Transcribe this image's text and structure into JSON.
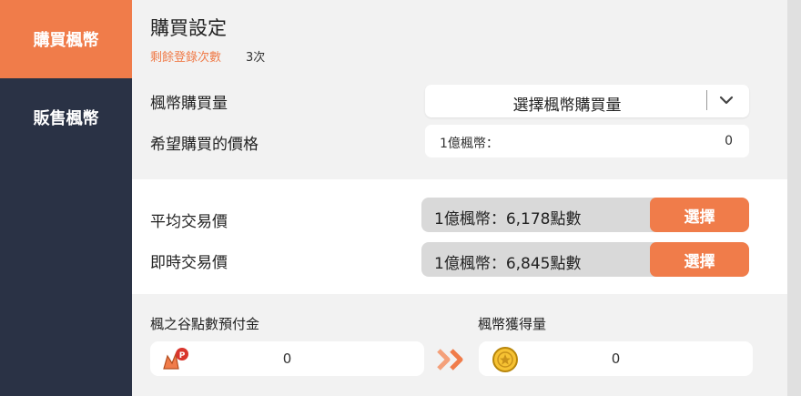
{
  "sidebar": {
    "tabs": [
      {
        "label": "購買楓幣",
        "active": true
      },
      {
        "label": "販售楓幣",
        "active": false
      }
    ]
  },
  "purchase_settings": {
    "title": "購買設定",
    "remaining_label": "剩餘登錄次數",
    "remaining_count": "3次"
  },
  "form": {
    "amount_label": "楓幣購買量",
    "amount_select": "選擇楓幣購買量",
    "price_label": "希望購買的價格",
    "price_unit": "1億楓幣：",
    "price_value": "0"
  },
  "trade": {
    "average_label": "平均交易價",
    "average_value": "1億楓幣：6,178點數",
    "realtime_label": "即時交易價",
    "realtime_value": "1億楓幣：6,845點數",
    "select_button": "選擇"
  },
  "exchange": {
    "points_label": "楓之谷點數預付金",
    "points_value": "0",
    "mesos_label": "楓幣獲得量",
    "mesos_value": "0"
  },
  "colors": {
    "accent": "#f07c4a",
    "sidebar": "#2a3245"
  }
}
